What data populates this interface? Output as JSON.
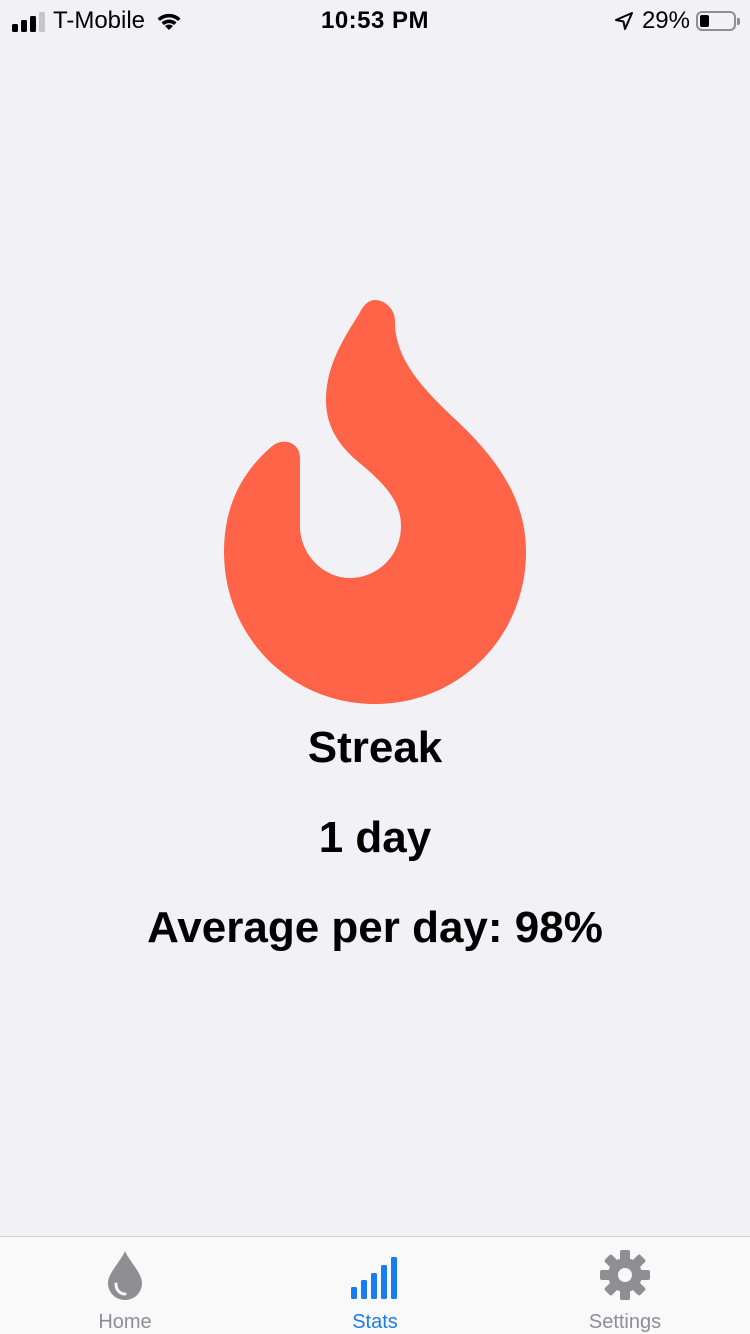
{
  "status_bar": {
    "carrier": "T-Mobile",
    "time": "10:53 PM",
    "battery_percent_label": "29%",
    "battery_level": 0.29,
    "signal_bars_active": 3,
    "signal_bars_total": 4
  },
  "main": {
    "icon": "flame-icon",
    "title": "Streak",
    "streak_value": "1 day",
    "average_text": "Average per day: 98%"
  },
  "tab_bar": {
    "tabs": [
      {
        "label": "Home",
        "icon": "water-drop-icon",
        "selected": false
      },
      {
        "label": "Stats",
        "icon": "bar-chart-icon",
        "selected": true
      },
      {
        "label": "Settings",
        "icon": "gear-icon",
        "selected": false
      }
    ]
  },
  "colors": {
    "background": "#f2f2f6",
    "flame": "#ff6348",
    "tab_active": "#1a7cf2",
    "tab_inactive": "#8e8e93"
  }
}
